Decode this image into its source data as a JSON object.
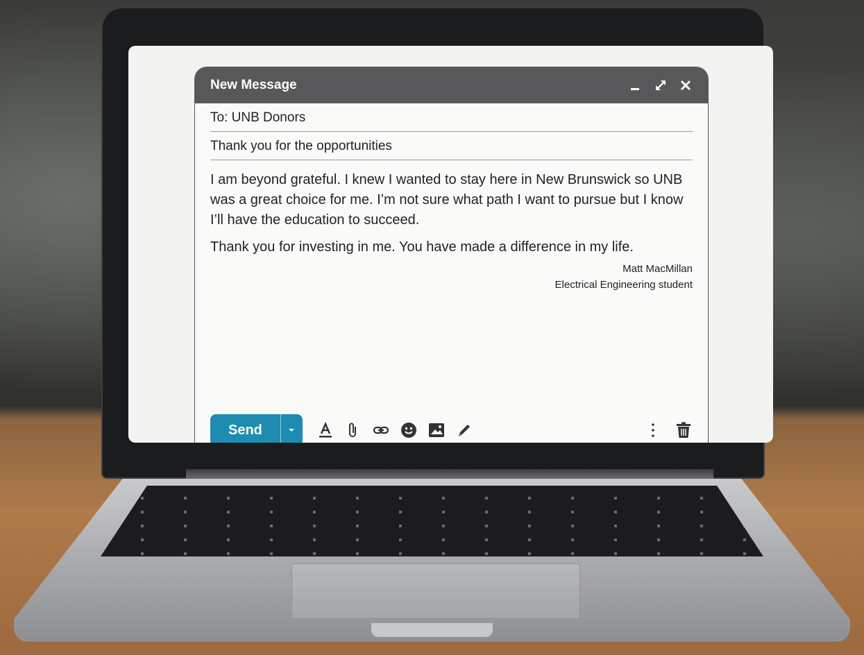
{
  "compose": {
    "title": "New Message",
    "to": "To: UNB Donors",
    "subject": "Thank you for the opportunities",
    "body": [
      "I am beyond grateful. I knew I wanted to stay here in New Brunswick so UNB was a great choice for me. I’m not sure what path I want to pursue but I know I’ll have the education to succeed.",
      "Thank you for investing in me. You have made a difference in my life."
    ],
    "signature": {
      "name": "Matt MacMillan",
      "role": "Electrical Engineering student"
    },
    "send_label": "Send"
  },
  "icons": {
    "window": [
      "minimize-icon",
      "expand-icon",
      "close-icon"
    ],
    "toolbar": [
      "format-text-icon",
      "attach-icon",
      "link-icon",
      "emoji-icon",
      "image-icon",
      "pen-icon"
    ],
    "right": [
      "more-vertical-icon",
      "trash-icon"
    ]
  },
  "colors": {
    "header": "#58585a",
    "send": "#1d8cb0"
  }
}
